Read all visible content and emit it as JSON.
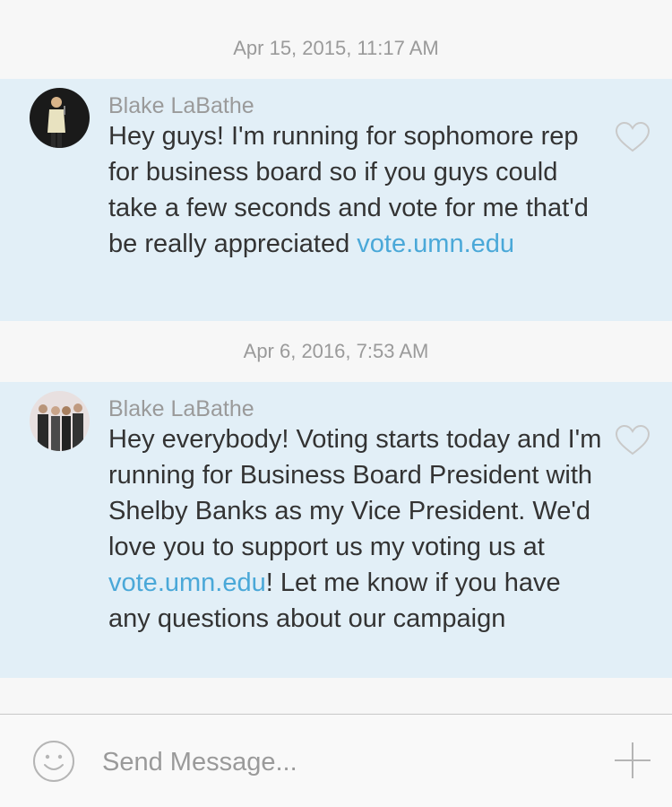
{
  "thread": {
    "messages": [
      {
        "timestamp": "Apr 15, 2015, 11:17 AM",
        "sender": "Blake LaBathe",
        "text_before": "Hey guys! I'm running for sophomore rep for business board so if you guys could take a few seconds and vote for me that'd be really appreciated ",
        "link": "vote.umn.edu",
        "text_after": ""
      },
      {
        "timestamp": "Apr 6, 2016, 7:53 AM",
        "sender": "Blake LaBathe",
        "text_before": "Hey everybody! Voting starts today and I'm running for Business Board President with Shelby Banks as my Vice President. We'd love you to support us my voting us at ",
        "link": "vote.umn.edu",
        "text_after": "! Let me know if you have any questions about our campaign"
      }
    ]
  },
  "composer": {
    "placeholder": "Send Message...",
    "emoji_icon": "smiley-icon",
    "add_icon": "plus-icon"
  },
  "icons": {
    "like": "heart-outline-icon"
  },
  "colors": {
    "message_background": "#e2eff7",
    "link": "#4aa8d8",
    "timestamp": "#9a9a9a",
    "page_background": "#f7f7f7"
  }
}
